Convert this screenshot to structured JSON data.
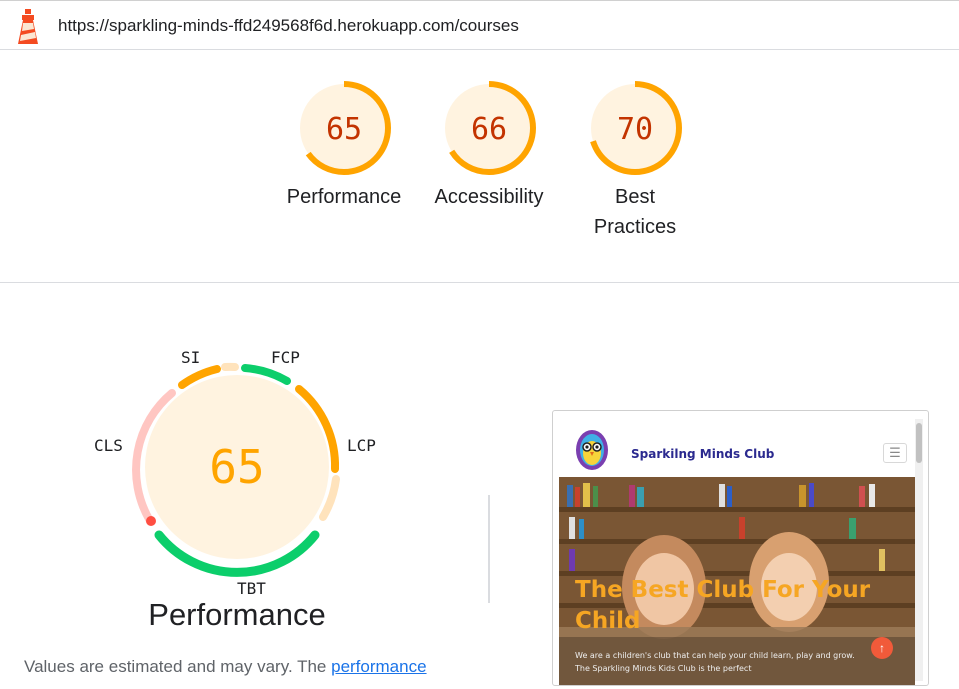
{
  "header": {
    "url": "https://sparkling-minds-ffd249568f6d.herokuapp.com/courses",
    "logo_icon": "lighthouse-icon"
  },
  "scores": [
    {
      "label": "Performance",
      "value": "65"
    },
    {
      "label": "Accessibility",
      "value": "66"
    },
    {
      "label": "Best Practices",
      "label_line1": "Best",
      "label_line2": "Practices",
      "value": "70"
    }
  ],
  "colors": {
    "average": "#ffa400",
    "average_bg": "#fff3e0",
    "average_text": "#c33300",
    "pass": "#0cce6b",
    "fail": "#ff4e42",
    "fail_light": "#ffc6c2",
    "average_light": "#ffe3bc",
    "link": "#1a73e8"
  },
  "performance": {
    "score": "65",
    "title": "Performance",
    "metrics": {
      "si": "SI",
      "fcp": "FCP",
      "lcp": "LCP",
      "tbt": "TBT",
      "cls": "CLS"
    },
    "note_text": "Values are estimated and may vary. The ",
    "note_link": "performance"
  },
  "preview": {
    "site_name": "Sparkilng Minds Club",
    "hero_title": "The Best Club For Your Child",
    "hero_text": "We are a children's club that can help your child learn, play and grow. The Sparkling Minds Kids Club is the perfect",
    "menu_icon": "hamburger-menu-icon",
    "scroll_top_icon": "arrow-up-icon"
  }
}
